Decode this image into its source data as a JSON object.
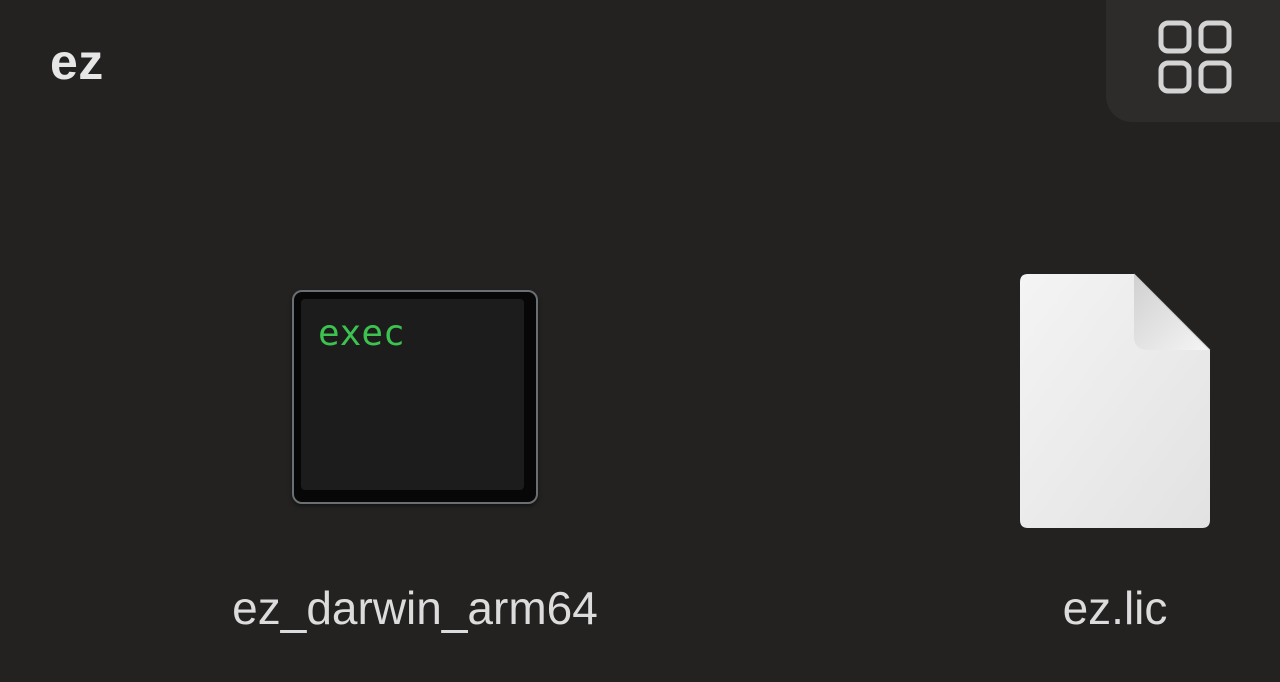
{
  "window": {
    "title": "ez"
  },
  "toolbar": {
    "view_toggle_icon": "grid-view-icon"
  },
  "files": [
    {
      "name": "ez_darwin_arm64",
      "icon": "terminal-exec-icon",
      "icon_label": "exec"
    },
    {
      "name": "ez.lic",
      "icon": "document-icon"
    }
  ],
  "colors": {
    "background": "#232221",
    "exec_text": "#3dc24f",
    "label_text": "#dcdcdc"
  }
}
